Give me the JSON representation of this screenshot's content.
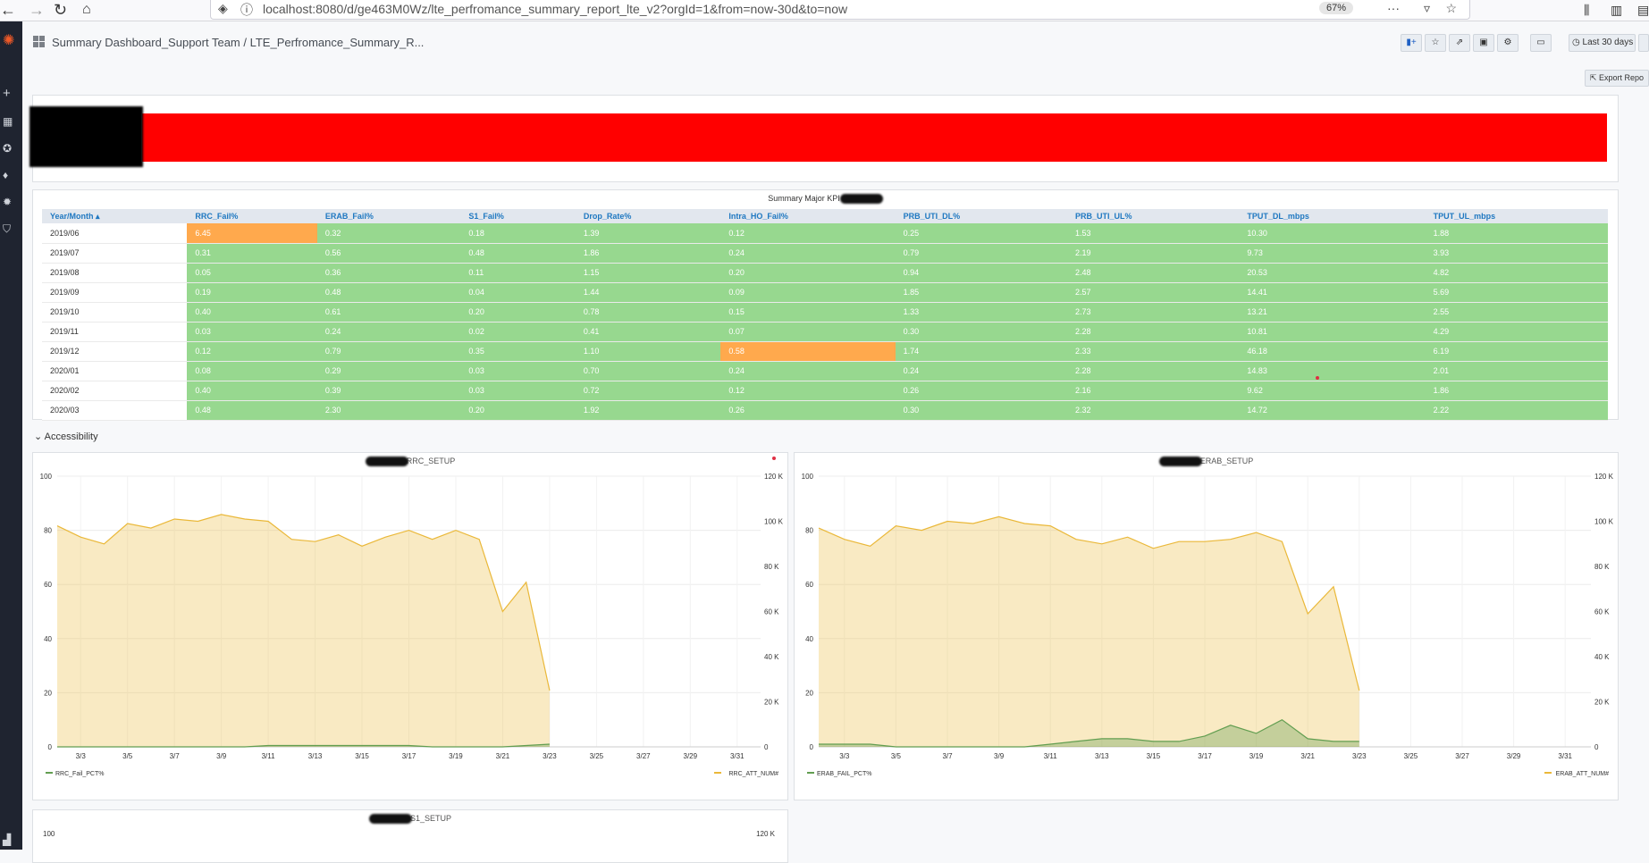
{
  "browser": {
    "url": "localhost:8080/d/ge463M0Wz/lte_perfromance_summary_report_lte_v2?orgId=1&from=now-30d&to=now",
    "zoom": "67%"
  },
  "header": {
    "breadcrumb": "Summary Dashboard_Support Team / LTE_Perfromance_Summary_R...",
    "time_range": "Last 30 days",
    "export_label": "Export Repo"
  },
  "table": {
    "title": "Summary Major KPI",
    "columns": [
      "Year/Month ▴",
      "RRC_Fail%",
      "ERAB_Fail%",
      "S1_Fail%",
      "Drop_Rate%",
      "Intra_HO_Fail%",
      "PRB_UTI_DL%",
      "PRB_UTI_UL%",
      "TPUT_DL_mbps",
      "TPUT_UL_mbps"
    ],
    "rows": [
      [
        "2019/06",
        "6.45",
        "0.32",
        "0.18",
        "1.39",
        "0.12",
        "0.25",
        "1.53",
        "10.30",
        "1.88"
      ],
      [
        "2019/07",
        "0.31",
        "0.56",
        "0.48",
        "1.86",
        "0.24",
        "0.79",
        "2.19",
        "9.73",
        "3.93"
      ],
      [
        "2019/08",
        "0.05",
        "0.36",
        "0.11",
        "1.15",
        "0.20",
        "0.94",
        "2.48",
        "20.53",
        "4.82"
      ],
      [
        "2019/09",
        "0.19",
        "0.48",
        "0.04",
        "1.44",
        "0.09",
        "1.85",
        "2.57",
        "14.41",
        "5.69"
      ],
      [
        "2019/10",
        "0.40",
        "0.61",
        "0.20",
        "0.78",
        "0.15",
        "1.33",
        "2.73",
        "13.21",
        "2.55"
      ],
      [
        "2019/11",
        "0.03",
        "0.24",
        "0.02",
        "0.41",
        "0.07",
        "0.30",
        "2.28",
        "10.81",
        "4.29"
      ],
      [
        "2019/12",
        "0.12",
        "0.79",
        "0.35",
        "1.10",
        "0.58",
        "1.74",
        "2.33",
        "46.18",
        "6.19"
      ],
      [
        "2020/01",
        "0.08",
        "0.29",
        "0.03",
        "0.70",
        "0.24",
        "0.24",
        "2.28",
        "14.83",
        "2.01"
      ],
      [
        "2020/02",
        "0.40",
        "0.39",
        "0.03",
        "0.72",
        "0.12",
        "0.26",
        "2.16",
        "9.62",
        "1.86"
      ],
      [
        "2020/03",
        "0.48",
        "2.30",
        "0.20",
        "1.92",
        "0.26",
        "0.30",
        "2.32",
        "14.72",
        "2.22"
      ]
    ],
    "highlight": [
      [
        0,
        1
      ],
      [
        6,
        5
      ]
    ],
    "colors": {
      "ok": "#97d88f",
      "warn": "#ffa94d"
    }
  },
  "section": {
    "accessibility": "Accessibility"
  },
  "chart_data": [
    {
      "type": "line",
      "title": "RRC_SETUP",
      "x": [
        "3/2",
        "3/3",
        "3/4",
        "3/5",
        "3/6",
        "3/7",
        "3/8",
        "3/9",
        "3/10",
        "3/11",
        "3/12",
        "3/13",
        "3/14",
        "3/15",
        "3/16",
        "3/17",
        "3/18",
        "3/19",
        "3/20",
        "3/21",
        "3/22",
        "3/23"
      ],
      "xticks": [
        "3/3",
        "3/5",
        "3/7",
        "3/9",
        "3/11",
        "3/13",
        "3/15",
        "3/17",
        "3/19",
        "3/21",
        "3/23",
        "3/25",
        "3/27",
        "3/29",
        "3/31"
      ],
      "ylim_left": [
        0,
        100
      ],
      "ylim_right": [
        0,
        120000
      ],
      "yticks_left": [
        "0",
        "20",
        "40",
        "60",
        "80",
        "100"
      ],
      "yticks_right": [
        "0",
        "20 K",
        "40 K",
        "60 K",
        "80 K",
        "100 K",
        "120 K"
      ],
      "series": [
        {
          "name": "RRC_ATT_NUM#",
          "axis": "right",
          "color": "#eab839",
          "values": [
            98000,
            93000,
            90000,
            99000,
            97000,
            101000,
            100000,
            103000,
            101000,
            100000,
            92000,
            91000,
            94000,
            89000,
            93000,
            96000,
            92000,
            96000,
            92000,
            60000,
            73000,
            25000
          ]
        },
        {
          "name": "RRC_Fail_PCT%",
          "axis": "left",
          "color": "#629e51",
          "values": [
            0,
            0,
            0,
            0,
            0,
            0,
            0,
            0,
            0,
            0.5,
            0.5,
            0.5,
            0.5,
            0.5,
            0.5,
            0.5,
            0,
            0,
            0,
            0,
            0.5,
            1
          ]
        }
      ]
    },
    {
      "type": "line",
      "title": "ERAB_SETUP",
      "x": [
        "3/2",
        "3/3",
        "3/4",
        "3/5",
        "3/6",
        "3/7",
        "3/8",
        "3/9",
        "3/10",
        "3/11",
        "3/12",
        "3/13",
        "3/14",
        "3/15",
        "3/16",
        "3/17",
        "3/18",
        "3/19",
        "3/20",
        "3/21",
        "3/22",
        "3/23"
      ],
      "xticks": [
        "3/3",
        "3/5",
        "3/7",
        "3/9",
        "3/11",
        "3/13",
        "3/15",
        "3/17",
        "3/19",
        "3/21",
        "3/23",
        "3/25",
        "3/27",
        "3/29",
        "3/31"
      ],
      "ylim_left": [
        0,
        100
      ],
      "ylim_right": [
        0,
        120000
      ],
      "yticks_left": [
        "0",
        "20",
        "40",
        "60",
        "80",
        "100"
      ],
      "yticks_right": [
        "0",
        "20 K",
        "40 K",
        "60 K",
        "80 K",
        "100 K",
        "120 K"
      ],
      "series": [
        {
          "name": "ERAB_ATT_NUM#",
          "axis": "right",
          "color": "#eab839",
          "values": [
            97000,
            92000,
            89000,
            98000,
            96000,
            100000,
            99000,
            102000,
            99000,
            98000,
            92000,
            90000,
            93000,
            88000,
            91000,
            91000,
            92000,
            95000,
            91000,
            59000,
            71000,
            25000
          ]
        },
        {
          "name": "ERAB_FAIL_PCT%",
          "axis": "left",
          "color": "#629e51",
          "values": [
            1,
            1,
            1,
            0,
            0,
            0,
            0,
            0,
            0,
            1,
            2,
            3,
            3,
            2,
            2,
            4,
            8,
            5,
            10,
            3,
            2,
            2
          ]
        }
      ]
    },
    {
      "type": "line",
      "title": "S1_SETUP",
      "yticks_left": [
        "100"
      ],
      "yticks_right": [
        "120 K"
      ]
    }
  ]
}
